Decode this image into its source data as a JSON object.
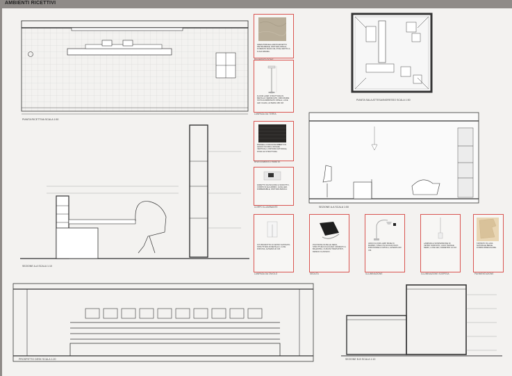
{
  "sheet": {
    "title": "AMBIENTI RICETTIVI"
  },
  "views": {
    "pianta_ricezione": "PIANTA RICETTIVA    SCALA 1:50",
    "pianta_attesa": "PIANTA SALA ATTESA/INGRESSO    SCALA 1:50",
    "sezione_aa_top": "SEZIONE A-A    SCALA 1:50",
    "sezione_aa_main": "SEZIONE A-A    SCALA 1:10",
    "prospetto_desk": "PROSPETTO DESK    SCALA 1:20",
    "sezione_bb": "SEZIONE B-B    SCALA 1:10"
  },
  "materials": [
    {
      "id": "pavimentazione",
      "caption": "PAVIMENTAZIONE",
      "text": "GRES PORCELLANATO EFFETTO PIETRA BEIGE, FINITURA OPACA, FORMATO 60x60 CM, POSA DRITTA A FUGA MINIMA."
    },
    {
      "id": "lampada",
      "caption": "LAMPADA DA TERRA",
      "text": "FLOOR LAMP, STRUTTURA IN METALLO VERNICIATO, DIFFUSORE IN POLICARBONATO OPALE, LUCE LED CALDA, ALTEZZA 180 CM."
    },
    {
      "id": "rivestimento",
      "caption": "RIVESTIMENTO PARETE",
      "text": "PANNELLI FONOASSORBENTI IN LEGNO SCURO A DOGHE VERTICALI, FINITURA NATURALE, POSA SU STRUTTURA."
    },
    {
      "id": "corpo",
      "caption": "CORPO ILLUMINANTE",
      "text": "FARETTO DA INCASSO A SOFFITTO, CORPO IN ALLUMINIO, LUCE LED, DIMMERABILE, FINITURA BIANCA."
    }
  ],
  "products": [
    {
      "id": "lampada-tavolo",
      "caption": "LAMPADA DA TAVOLO",
      "text": "KIT PRODOTTO IN VETRO SATINATO, STRUTTURA IN METALLO, LUCE DIFFUSA, ALTEZZA 40 CM."
    },
    {
      "id": "seduta",
      "caption": "SEDUTA",
      "text": "POLTRONA IN PELLE NERA, STRUTTURA IN ACCIAIO CROMATO A BALESTRA, CUSCINI TRAPUNTATI, DESIGN CLASSICO."
    },
    {
      "id": "illuminazione",
      "caption": "ILLUMINAZIONE",
      "text": "ARCO FLOOR LAMP, BASE IN MARMO, STELO IN ACCIAIO INOX, DIFFUSORE A CUPOLA, ALTEZZA 240 CM."
    },
    {
      "id": "sospensione",
      "caption": "ILLUMINAZIONE SOSPESA",
      "text": "LAMPADA A SOSPENSIONE IN VETRO SOFFIATO, CAVO TESSILE NERO, LUCE LED, DIAMETRO 14 CM."
    },
    {
      "id": "tappeto",
      "caption": "PAVIMENTAZIONE",
      "text": "TAPPETO IN LANA NATURALE BEIGE, FORMA IRREGOLARE."
    }
  ],
  "colors": {
    "paper": "#f3f2f0",
    "frame": "#8f8b88",
    "card_border": "#d9534f",
    "line": "#333333"
  }
}
